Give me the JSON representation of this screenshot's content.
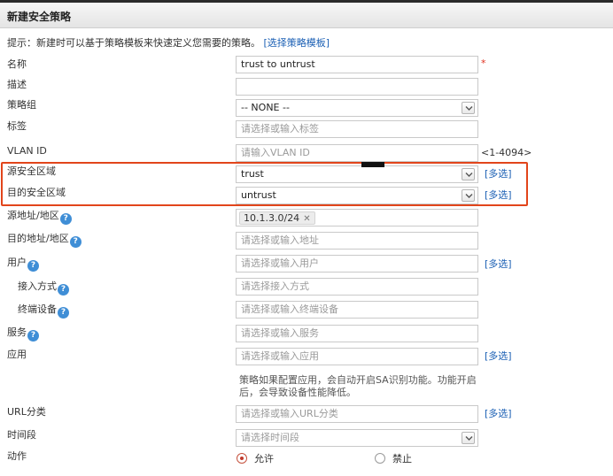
{
  "dialog": {
    "title": "新建安全策略"
  },
  "hint": {
    "text": "提示：新建时可以基于策略模板来快速定义您需要的策略。",
    "link": "[选择策略模板]"
  },
  "fields": {
    "name": {
      "label": "名称",
      "value": "trust to untrust",
      "required_mark": "*"
    },
    "description": {
      "label": "描述",
      "value": ""
    },
    "policy_group": {
      "label": "策略组",
      "value": "-- NONE --"
    },
    "tag": {
      "label": "标签",
      "placeholder": "请选择或输入标签"
    },
    "vlan": {
      "label": "VLAN ID",
      "placeholder": "请输入VLAN ID",
      "range": "<1-4094>"
    },
    "src_zone": {
      "label": "源安全区域",
      "value": "trust",
      "multi": "[多选]"
    },
    "dst_zone": {
      "label": "目的安全区域",
      "value": "untrust",
      "multi": "[多选]"
    },
    "src_addr": {
      "label": "源地址/地区",
      "tag_value": "10.1.3.0/24",
      "tag_remove": "✕"
    },
    "dst_addr": {
      "label": "目的地址/地区",
      "placeholder": "请选择或输入地址"
    },
    "user": {
      "label": "用户",
      "placeholder": "请选择或输入用户",
      "multi": "[多选]"
    },
    "access_mode": {
      "label": "接入方式",
      "placeholder": "请选择接入方式"
    },
    "terminal": {
      "label": "终端设备",
      "placeholder": "请选择或输入终端设备"
    },
    "service": {
      "label": "服务",
      "placeholder": "请选择或输入服务"
    },
    "application": {
      "label": "应用",
      "placeholder": "请选择或输入应用",
      "multi": "[多选]",
      "note": "策略如果配置应用，会自动开启SA识别功能。功能开启后，会导致设备性能降低。"
    },
    "url_category": {
      "label": "URL分类",
      "placeholder": "请选择或输入URL分类",
      "multi": "[多选]"
    },
    "time_range": {
      "label": "时间段",
      "placeholder": "请选择时间段"
    },
    "action": {
      "label": "动作",
      "options": [
        "允许",
        "禁止"
      ],
      "selected": "允许"
    }
  },
  "help_icon_glyph": "?",
  "colors": {
    "link": "#1a5fb4",
    "highlight": "#e2451b",
    "required": "#e0301e",
    "help_icon": "#3f8ed6"
  }
}
